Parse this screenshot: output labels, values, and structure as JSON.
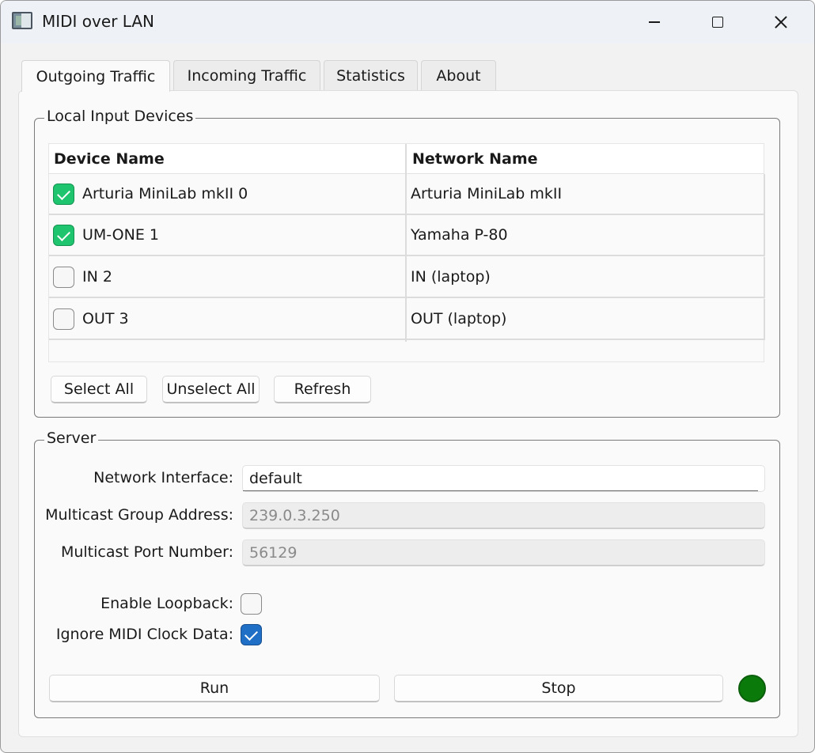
{
  "window": {
    "title": "MIDI over LAN"
  },
  "tabs": [
    {
      "label": "Outgoing Traffic",
      "active": true
    },
    {
      "label": "Incoming Traffic",
      "active": false
    },
    {
      "label": "Statistics",
      "active": false
    },
    {
      "label": "About",
      "active": false
    }
  ],
  "local_inputs": {
    "group_title": "Local Input Devices",
    "columns": [
      "Device Name",
      "Network Name"
    ],
    "rows": [
      {
        "device": "Arturia MiniLab mkII 0",
        "network": "Arturia MiniLab mkII",
        "checked": true
      },
      {
        "device": "UM-ONE 1",
        "network": "Yamaha P-80",
        "checked": true
      },
      {
        "device": "IN 2",
        "network": "IN (laptop)",
        "checked": false
      },
      {
        "device": "OUT 3",
        "network": "OUT (laptop)",
        "checked": false
      }
    ],
    "buttons": {
      "select_all": "Select All",
      "unselect_all": "Unselect All",
      "refresh": "Refresh"
    }
  },
  "server": {
    "group_title": "Server",
    "network_interface_label": "Network Interface:",
    "network_interface_value": "default",
    "multicast_group_label": "Multicast Group Address:",
    "multicast_group_value": "239.0.3.250",
    "multicast_port_label": "Multicast Port Number:",
    "multicast_port_value": "56129",
    "enable_loopback_label": "Enable Loopback:",
    "enable_loopback_checked": false,
    "ignore_clock_label": "Ignore MIDI Clock Data:",
    "ignore_clock_checked": true,
    "run_label": "Run",
    "stop_label": "Stop",
    "status_color": "#0a7a0a"
  },
  "colors": {
    "check_green": "#1fc46e",
    "check_blue": "#1f6fc7"
  }
}
